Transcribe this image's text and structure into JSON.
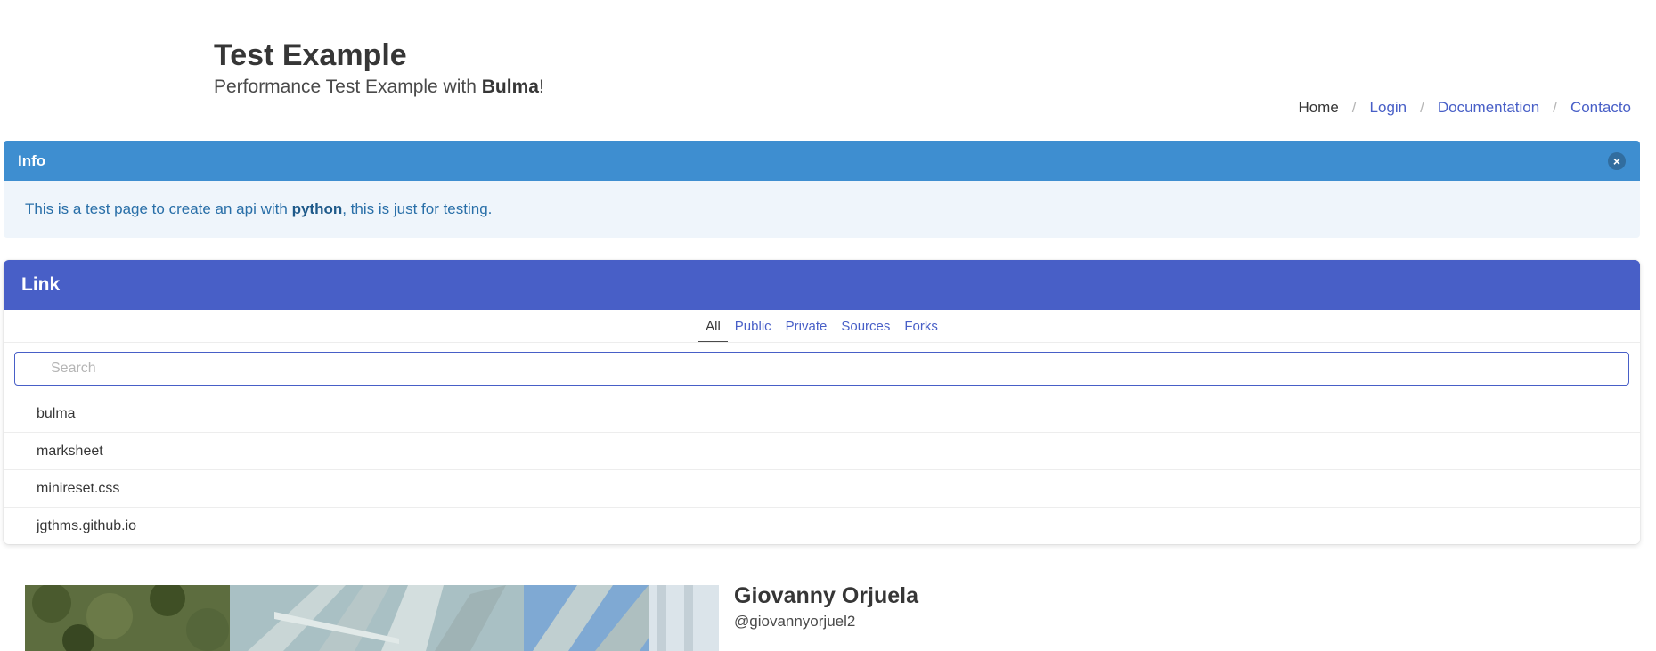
{
  "hero": {
    "title": "Test Example",
    "subtitle_prefix": "Performance Test Example with ",
    "subtitle_bold": "Bulma",
    "subtitle_suffix": "!"
  },
  "breadcrumb": [
    {
      "label": "Home",
      "active": true
    },
    {
      "label": "Login"
    },
    {
      "label": "Documentation"
    },
    {
      "label": "Contacto"
    }
  ],
  "message": {
    "header": "Info",
    "close_icon": "close-icon",
    "body_prefix": "This is a test page to create an api with ",
    "body_bold": "python",
    "body_suffix": ", this is just for testing.",
    "colors": {
      "header": "#3e8ed0",
      "body_bg": "#eff5fb",
      "body_text": "#296fa8"
    }
  },
  "panel": {
    "heading": "Link",
    "tabs": [
      {
        "label": "All",
        "active": true
      },
      {
        "label": "Public"
      },
      {
        "label": "Private"
      },
      {
        "label": "Sources"
      },
      {
        "label": "Forks"
      }
    ],
    "search_placeholder": "Search",
    "search_value": "",
    "repos": [
      "bulma",
      "marksheet",
      "minireset.css",
      "jgthms.github.io"
    ],
    "colors": {
      "heading": "#485fc7"
    }
  },
  "profile": {
    "name": "Giovanny Orjuela",
    "handle": "@giovannyorjuel2"
  }
}
